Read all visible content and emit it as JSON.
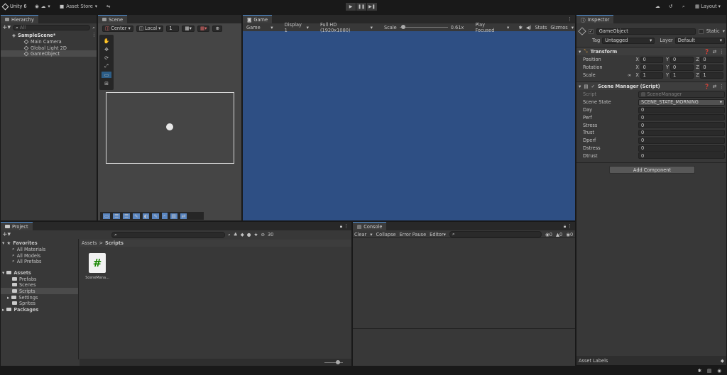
{
  "toolbar": {
    "unity": "Unity 6",
    "asset_store": "Asset Store",
    "layout": "Layout"
  },
  "hierarchy": {
    "tab": "Hierarchy",
    "search_placeholder": "All",
    "scene": "SampleScene*",
    "items": [
      "Main Camera",
      "Global Light 2D",
      "GameObject"
    ]
  },
  "scene_view": {
    "tab": "Scene",
    "pivot": "Center",
    "space": "Local",
    "snap": "1"
  },
  "game_view": {
    "tab": "Game",
    "mode": "Game",
    "display": "Display 1",
    "resolution": "Full HD (1920x1080)",
    "scale_label": "Scale",
    "scale_value": "0.61x",
    "play_focus": "Play Focused",
    "stats": "Stats",
    "gizmos": "Gizmos",
    "bg": "#2e4f84"
  },
  "inspector": {
    "tab": "Inspector",
    "name": "GameObject",
    "static": "Static",
    "tag_label": "Tag",
    "tag": "Untagged",
    "layer_label": "Layer",
    "layer": "Default",
    "transform": {
      "title": "Transform",
      "rows": [
        {
          "label": "Position",
          "x": "0",
          "y": "0",
          "z": "0"
        },
        {
          "label": "Rotation",
          "x": "0",
          "y": "0",
          "z": "0"
        },
        {
          "label": "Scale",
          "x": "1",
          "y": "1",
          "z": "1"
        }
      ]
    },
    "script": {
      "title": "Scene Manager (Script)",
      "script_label": "Script",
      "script_value": "SceneManager",
      "state_label": "Scene State",
      "state_value": "SCENE_STATE_MORNING",
      "fields": [
        {
          "label": "Day",
          "value": "0"
        },
        {
          "label": "Perf",
          "value": "0"
        },
        {
          "label": "Stress",
          "value": "0"
        },
        {
          "label": "Trust",
          "value": "0"
        },
        {
          "label": "Dperf",
          "value": "0"
        },
        {
          "label": "Dstress",
          "value": "0"
        },
        {
          "label": "Dtrust",
          "value": "0"
        }
      ]
    },
    "add_component": "Add Component",
    "asset_labels": "Asset Labels"
  },
  "project": {
    "tab": "Project",
    "favorites": "Favorites",
    "fav_items": [
      "All Materials",
      "All Models",
      "All Prefabs"
    ],
    "assets": "Assets",
    "asset_folders": [
      "Prefabs",
      "Scenes",
      "Scripts",
      "Settings",
      "Sprites"
    ],
    "packages": "Packages",
    "breadcrumb_root": "Assets",
    "breadcrumb_leaf": "Scripts",
    "file_name": "SceneMana...",
    "hidden_count": "30"
  },
  "console": {
    "tab": "Console",
    "clear": "Clear",
    "collapse": "Collapse",
    "error_pause": "Error Pause",
    "editor": "Editor",
    "c_log": "0",
    "c_warn": "0",
    "c_err": "0"
  }
}
